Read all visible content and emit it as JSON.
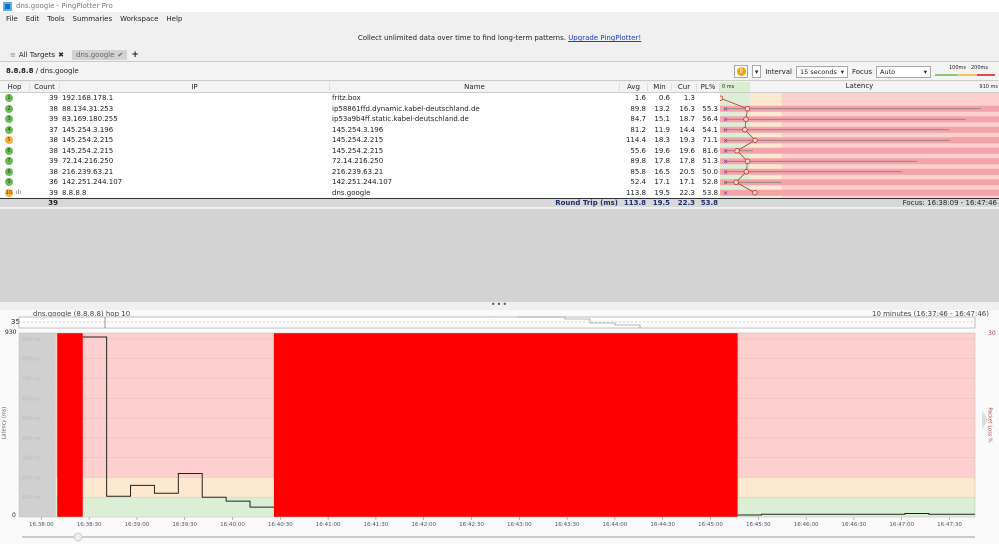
{
  "window": {
    "title": "dns.google - PingPlotter Pro"
  },
  "menu": [
    "File",
    "Edit",
    "Tools",
    "Summaries",
    "Workspace",
    "Help"
  ],
  "banner": {
    "text": "Collect unlimited data over time to find long-term patterns.",
    "link": "Upgrade PingPlotter!"
  },
  "tabs": [
    {
      "label": "All Targets",
      "icon": "list-icon",
      "close": "✖"
    },
    {
      "label": "dns.google",
      "icon": "check-icon",
      "close": "✔"
    }
  ],
  "add_tab": "+",
  "breadcrumb": {
    "ip": "8.8.8.8",
    "sep": " / ",
    "name": "dns.google"
  },
  "toolbar": {
    "pause_icon": "pause-icon",
    "interval_label": "Interval",
    "interval_value": "15 seconds",
    "focus_label": "Focus",
    "focus_value": "Auto",
    "scale_100": "100ms",
    "scale_200": "200ms"
  },
  "colors": {
    "good": "#6dbb5a",
    "warn": "#f2b33d",
    "bad": "#ff0000",
    "band_green": "#dcefd6",
    "band_yellow": "#fde9cf",
    "band_red": "#fdd0cf"
  },
  "table": {
    "headers": {
      "hop": "Hop",
      "count": "Count",
      "ip": "IP",
      "name": "Name",
      "avg": "Avg",
      "min": "Min",
      "cur": "Cur",
      "pl": "PL%",
      "latency": "Latency",
      "lat_min": "0 ms",
      "lat_max": "910 ms"
    },
    "latency_max_ms": 910,
    "rows": [
      {
        "hop": "1",
        "status": "good",
        "count": "39",
        "ip": "192.168.178.1",
        "name": "fritz.box",
        "avg": "1.6",
        "min": "0.6",
        "cur": "1.3",
        "pl": "",
        "max_ms": 0
      },
      {
        "hop": "2",
        "status": "good",
        "count": "38",
        "ip": "88.134.31.253",
        "name": "ip58861ffd.dynamic.kabel-deutschland.de",
        "avg": "89.8",
        "min": "13.2",
        "cur": "16.3",
        "pl": "55.3",
        "max_ms": 850
      },
      {
        "hop": "3",
        "status": "good",
        "count": "39",
        "ip": "83.169.180.255",
        "name": "ip53a9b4ff.static.kabel-deutschland.de",
        "avg": "84.7",
        "min": "15.1",
        "cur": "18.7",
        "pl": "56.4",
        "max_ms": 800
      },
      {
        "hop": "4",
        "status": "good",
        "count": "37",
        "ip": "145.254.3.196",
        "name": "145.254.3.196",
        "avg": "81.2",
        "min": "11.9",
        "cur": "14.4",
        "pl": "54.1",
        "max_ms": 750
      },
      {
        "hop": "5",
        "status": "warn",
        "count": "38",
        "ip": "145.254.2.215",
        "name": "145.254.2.215",
        "avg": "114.4",
        "min": "18.3",
        "cur": "19.3",
        "pl": "71.1",
        "max_ms": 750
      },
      {
        "hop": "6",
        "status": "good",
        "count": "38",
        "ip": "145.254.2.215",
        "name": "145.254.2.215",
        "avg": "55.6",
        "min": "19.6",
        "cur": "19.6",
        "pl": "81.6",
        "max_ms": 107
      },
      {
        "hop": "7",
        "status": "good",
        "count": "39",
        "ip": "72.14.216.250",
        "name": "72.14.216.250",
        "avg": "89.8",
        "min": "17.8",
        "cur": "17.8",
        "pl": "51.3",
        "max_ms": 643
      },
      {
        "hop": "8",
        "status": "good",
        "count": "38",
        "ip": "216.239.63.21",
        "name": "216.239.63.21",
        "avg": "85.8",
        "min": "16.5",
        "cur": "20.5",
        "pl": "50.0",
        "max_ms": 593
      },
      {
        "hop": "9",
        "status": "good",
        "count": "36",
        "ip": "142.251.244.107",
        "name": "142.251.244.107",
        "avg": "52.4",
        "min": "17.1",
        "cur": "17.1",
        "pl": "52.8",
        "max_ms": 200
      },
      {
        "hop": "10",
        "status": "warn",
        "count": "39",
        "ip": "8.8.8.8",
        "name": "dns.google",
        "avg": "113.8",
        "min": "19.5",
        "cur": "22.3",
        "pl": "53.8",
        "max_ms": 0,
        "graph_icon": true
      }
    ],
    "summary": {
      "count": "39",
      "label": "Round Trip (ms)",
      "avg": "113.8",
      "min": "19.5",
      "cur": "22.3",
      "pl": "53.8",
      "focus": "Focus: 16:38:09 - 16:47:46"
    }
  },
  "graph": {
    "title": "dns.google (8.8.8.8) hop 10",
    "range": "10 minutes (16:37:46 - 16:47:46)",
    "jitter_label": "Jitter (ms)",
    "jitter_max": "35",
    "y_top": "930",
    "y_zero": "0",
    "y_label": "Latency (ms)",
    "y_gridlabels": [
      "900 ms",
      "800 ms",
      "700 ms",
      "600 ms",
      "500 ms",
      "400 ms",
      "300 ms",
      "200 ms",
      "100 ms"
    ],
    "right_top": "30",
    "right_label": "Packet Loss %"
  },
  "chart_data": {
    "type": "line",
    "xlim": [
      "16:37:46",
      "16:47:46"
    ],
    "ylim": [
      0,
      930
    ],
    "ylabel": "Latency (ms)",
    "y2label": "Packet Loss %",
    "x_ticks": [
      "16:38:00",
      "16:38:30",
      "16:39:00",
      "16:39:30",
      "16:40:00",
      "16:40:30",
      "16:41:00",
      "16:41:30",
      "16:42:00",
      "16:42:30",
      "16:43:00",
      "16:43:30",
      "16:44:00",
      "16:44:30",
      "16:45:00",
      "16:45:30",
      "16:46:00",
      "16:46:30",
      "16:47:00",
      "16:47:30"
    ],
    "bands": [
      {
        "from": 0,
        "to": 100,
        "color": "#dcefd6"
      },
      {
        "from": 100,
        "to": 200,
        "color": "#fde9cf"
      },
      {
        "from": 200,
        "to": 930,
        "color": "#fdd0cf"
      }
    ],
    "no_data": [
      {
        "from": "16:37:46",
        "to": "16:38:09"
      }
    ],
    "packet_loss_periods": [
      {
        "from": "16:38:10",
        "to": "16:38:26"
      },
      {
        "from": "16:40:26",
        "to": "16:45:17"
      }
    ],
    "latency": [
      {
        "t": "16:38:26",
        "ms": 910
      },
      {
        "t": "16:38:41",
        "ms": 105
      },
      {
        "t": "16:38:56",
        "ms": 160
      },
      {
        "t": "16:39:11",
        "ms": 120
      },
      {
        "t": "16:39:26",
        "ms": 220
      },
      {
        "t": "16:39:41",
        "ms": 100
      },
      {
        "t": "16:39:56",
        "ms": 80
      },
      {
        "t": "16:40:11",
        "ms": 50
      },
      {
        "t": "16:40:26",
        "ms": null
      },
      {
        "t": "16:45:17",
        "ms": 10
      },
      {
        "t": "16:45:32",
        "ms": 14
      },
      {
        "t": "16:46:47",
        "ms": 14
      },
      {
        "t": "16:47:02",
        "ms": 18
      },
      {
        "t": "16:47:17",
        "ms": 14
      },
      {
        "t": "16:47:46",
        "ms": 14
      }
    ]
  }
}
